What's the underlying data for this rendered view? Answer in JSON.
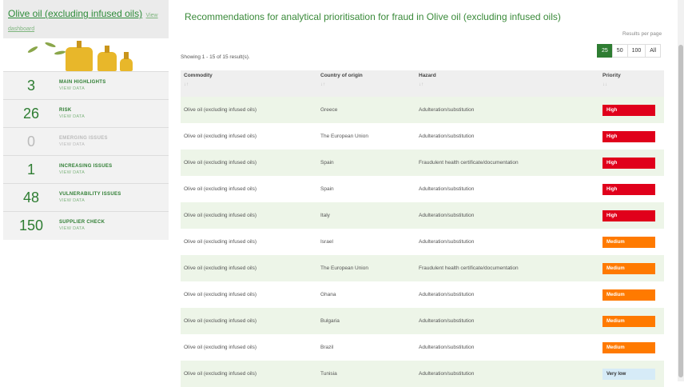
{
  "sidebar": {
    "title": "Olive oil (excluding infused oils)",
    "dashboard_link": "View dashboard",
    "stats": [
      {
        "number": "3",
        "label": "MAIN HIGHLIGHTS",
        "link": "VIEW DATA"
      },
      {
        "number": "26",
        "label": "RISK",
        "link": "VIEW DATA"
      },
      {
        "number": "0",
        "label": "EMERGING ISSUES",
        "link": "VIEW DATA"
      },
      {
        "number": "1",
        "label": "INCREASING ISSUES",
        "link": "VIEW DATA"
      },
      {
        "number": "48",
        "label": "VULNERABILITY ISSUES",
        "link": "VIEW DATA"
      },
      {
        "number": "150",
        "label": "SUPPLIER CHECK",
        "link": "VIEW DATA"
      }
    ]
  },
  "main": {
    "title": "Recommendations for analytical prioritisation for fraud in Olive oil (excluding infused oils)",
    "results_per_page": "Results per page",
    "showing": "Showing 1 - 15 of 15 result(s).",
    "page_sizes": [
      "25",
      "50",
      "100",
      "All"
    ],
    "columns": [
      "Commodity",
      "Country of origin",
      "Hazard",
      "Priority"
    ],
    "sort_icons": [
      "↓↑",
      "↓↑",
      "↓↑",
      "↓↓"
    ],
    "rows": [
      {
        "commodity": "Olive oil (excluding infused oils)",
        "country": "Greece",
        "hazard": "Adulteration/substitution",
        "priority": "High"
      },
      {
        "commodity": "Olive oil (excluding infused oils)",
        "country": "The European Union",
        "hazard": "Adulteration/substitution",
        "priority": "High"
      },
      {
        "commodity": "Olive oil (excluding infused oils)",
        "country": "Spain",
        "hazard": "Fraudulent health certificate/documentation",
        "priority": "High"
      },
      {
        "commodity": "Olive oil (excluding infused oils)",
        "country": "Spain",
        "hazard": "Adulteration/substitution",
        "priority": "High"
      },
      {
        "commodity": "Olive oil (excluding infused oils)",
        "country": "Italy",
        "hazard": "Adulteration/substitution",
        "priority": "High"
      },
      {
        "commodity": "Olive oil (excluding infused oils)",
        "country": "Israel",
        "hazard": "Adulteration/substitution",
        "priority": "Medium"
      },
      {
        "commodity": "Olive oil (excluding infused oils)",
        "country": "The European Union",
        "hazard": "Fraudulent health certificate/documentation",
        "priority": "Medium"
      },
      {
        "commodity": "Olive oil (excluding infused oils)",
        "country": "Ghana",
        "hazard": "Adulteration/substitution",
        "priority": "Medium"
      },
      {
        "commodity": "Olive oil (excluding infused oils)",
        "country": "Bulgaria",
        "hazard": "Adulteration/substitution",
        "priority": "Medium"
      },
      {
        "commodity": "Olive oil (excluding infused oils)",
        "country": "Brazil",
        "hazard": "Adulteration/substitution",
        "priority": "Medium"
      },
      {
        "commodity": "Olive oil (excluding infused oils)",
        "country": "Tunisia",
        "hazard": "Adulteration/substitution",
        "priority": "Very low"
      }
    ]
  },
  "colors": {
    "accent": "#2e7d32",
    "high": "#e0001b",
    "medium": "#ff7a00",
    "very_low": "#d6ebf7",
    "row_alt": "#edf5e8"
  }
}
